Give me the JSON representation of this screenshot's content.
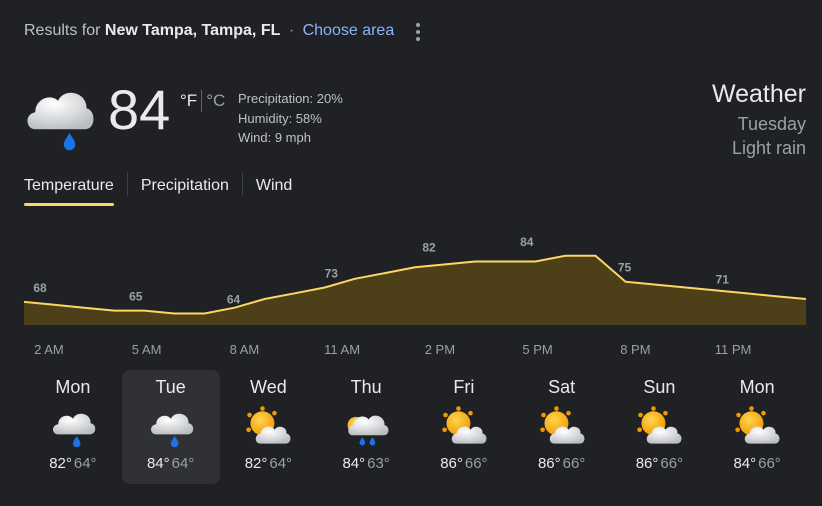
{
  "location": {
    "prefix": "Results for",
    "name": "New Tampa, Tampa, FL",
    "separator": "·",
    "choose_area": "Choose area"
  },
  "current": {
    "temp": "84",
    "unit_f": "°F",
    "unit_c": "°C",
    "icon": "rain-cloud-icon",
    "precipitation": "Precipitation: 20%",
    "humidity": "Humidity: 58%",
    "wind": "Wind: 9 mph"
  },
  "header": {
    "title": "Weather",
    "day": "Tuesday",
    "condition": "Light rain"
  },
  "tabs": [
    {
      "label": "Temperature",
      "active": true
    },
    {
      "label": "Precipitation",
      "active": false
    },
    {
      "label": "Wind",
      "active": false
    }
  ],
  "colors": {
    "accent": "#fdd663",
    "area_fill": "#4d4018",
    "background": "#202124",
    "rain_drop": "#1a73e8"
  },
  "chart_data": {
    "type": "area",
    "x": [
      "2 AM",
      "5 AM",
      "8 AM",
      "11 AM",
      "2 PM",
      "5 PM",
      "8 PM",
      "11 PM"
    ],
    "values": [
      68,
      65,
      64,
      73,
      82,
      84,
      75,
      71
    ],
    "hourly_curve": [
      68,
      67,
      66,
      65,
      65,
      64,
      64,
      66,
      69,
      71,
      73,
      76,
      78,
      80,
      81,
      82,
      82,
      82,
      84,
      84,
      75,
      74,
      73,
      72,
      71,
      70,
      69
    ]
  },
  "days": [
    {
      "name": "Mon",
      "icon": "rain-cloud-icon",
      "high": "82°",
      "low": "64°",
      "selected": false
    },
    {
      "name": "Tue",
      "icon": "rain-cloud-icon",
      "high": "84°",
      "low": "64°",
      "selected": true
    },
    {
      "name": "Wed",
      "icon": "partly-sunny-icon",
      "high": "82°",
      "low": "64°",
      "selected": false
    },
    {
      "name": "Thu",
      "icon": "sun-rain-cloud-icon",
      "high": "84°",
      "low": "63°",
      "selected": false
    },
    {
      "name": "Fri",
      "icon": "partly-sunny-icon",
      "high": "86°",
      "low": "66°",
      "selected": false
    },
    {
      "name": "Sat",
      "icon": "partly-sunny-icon",
      "high": "86°",
      "low": "66°",
      "selected": false
    },
    {
      "name": "Sun",
      "icon": "partly-sunny-icon",
      "high": "86°",
      "low": "66°",
      "selected": false
    },
    {
      "name": "Mon",
      "icon": "partly-sunny-icon",
      "high": "84°",
      "low": "66°",
      "selected": false
    }
  ]
}
